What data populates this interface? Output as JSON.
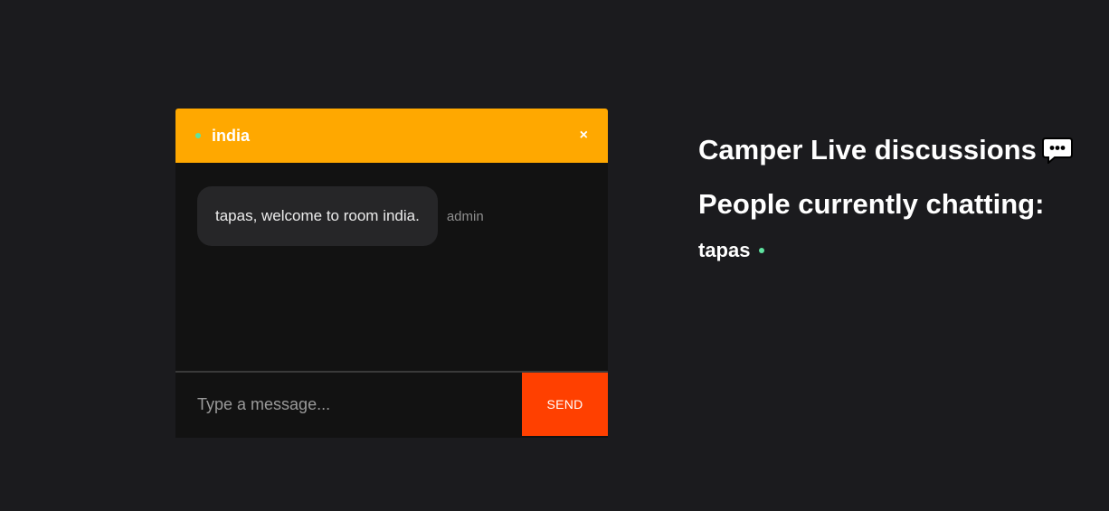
{
  "chat": {
    "room_name": "india",
    "close_label": "×",
    "messages": [
      {
        "text": "tapas, welcome to room india.",
        "sender": "admin"
      }
    ],
    "input_placeholder": "Type a message...",
    "send_label": "SEND"
  },
  "sidebar": {
    "title": "Camper Live discussions",
    "title_icon": "speech-bubble-icon",
    "subtitle": "People currently chatting:",
    "users": [
      {
        "name": "tapas",
        "status": "online"
      }
    ]
  },
  "colors": {
    "header_accent": "#ffa800",
    "send_button": "#ff4000",
    "online_dot": "#5fe3a0",
    "background": "#1b1b1e"
  }
}
